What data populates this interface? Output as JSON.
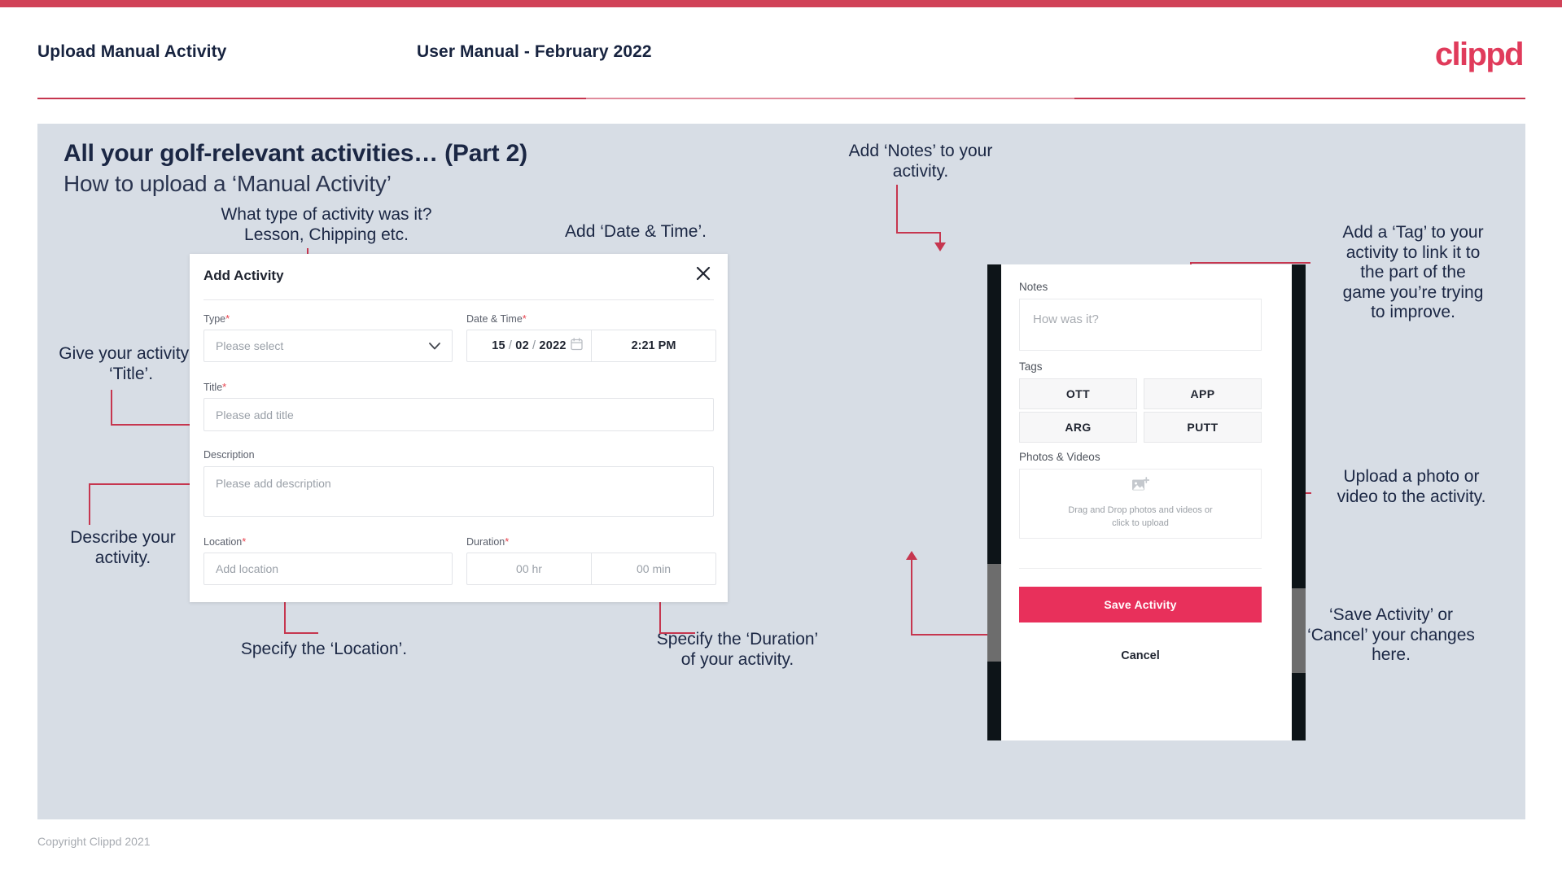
{
  "header": {
    "title": "Upload Manual Activity",
    "subtitle": "User Manual - February 2022",
    "logo": "clippd"
  },
  "slide": {
    "title": "All your golf-relevant activities… (Part 2)",
    "subtitle": "How to upload a ‘Manual Activity’"
  },
  "annotations": {
    "type": "What type of activity was it?\nLesson, Chipping etc.",
    "datetime": "Add ‘Date & Time’.",
    "title": "Give your activity a\n‘Title’.",
    "description": "Describe your\nactivity.",
    "location": "Specify the ‘Location’.",
    "duration": "Specify the ‘Duration’\nof your activity.",
    "notes": "Add ‘Notes’ to your\nactivity.",
    "tags": "Add a ‘Tag’ to your\nactivity to link it to\nthe part of the\ngame you’re trying\nto improve.",
    "photos": "Upload a photo or\nvideo to the activity.",
    "save": "‘Save Activity’ or\n‘Cancel’ your changes\nhere."
  },
  "dialog": {
    "title": "Add Activity",
    "close_icon": "close-icon",
    "fields": {
      "type": {
        "label": "Type",
        "required": "*",
        "placeholder": "Please select"
      },
      "datetime": {
        "label": "Date & Time",
        "required": "*",
        "day": "15",
        "month": "02",
        "year": "2022",
        "separator": "/",
        "time": "2:21 PM"
      },
      "title": {
        "label": "Title",
        "required": "*",
        "placeholder": "Please add title",
        "value": ""
      },
      "description": {
        "label": "Description",
        "required": "",
        "placeholder": "Please add description",
        "value": ""
      },
      "location": {
        "label": "Location",
        "required": "*",
        "placeholder": "Add location",
        "value": ""
      },
      "duration": {
        "label": "Duration",
        "required": "*",
        "hours": "00 hr",
        "minutes": "00 min"
      }
    }
  },
  "phone": {
    "notes": {
      "label": "Notes",
      "placeholder": "How was it?"
    },
    "tags": {
      "label": "Tags",
      "items": [
        "OTT",
        "APP",
        "ARG",
        "PUTT"
      ]
    },
    "photos": {
      "label": "Photos & Videos",
      "drop_text": "Drag and Drop photos and videos or\nclick to upload",
      "icon": "add-image-icon"
    },
    "save_label": "Save Activity",
    "cancel_label": "Cancel"
  },
  "footer": {
    "copyright": "Copyright Clippd 2021"
  },
  "colors": {
    "accent": "#e8305b",
    "brand_red": "#d14258",
    "annotation_line": "#c6364f",
    "slide_bg": "#d7dde5",
    "text_dark": "#1b2744"
  }
}
